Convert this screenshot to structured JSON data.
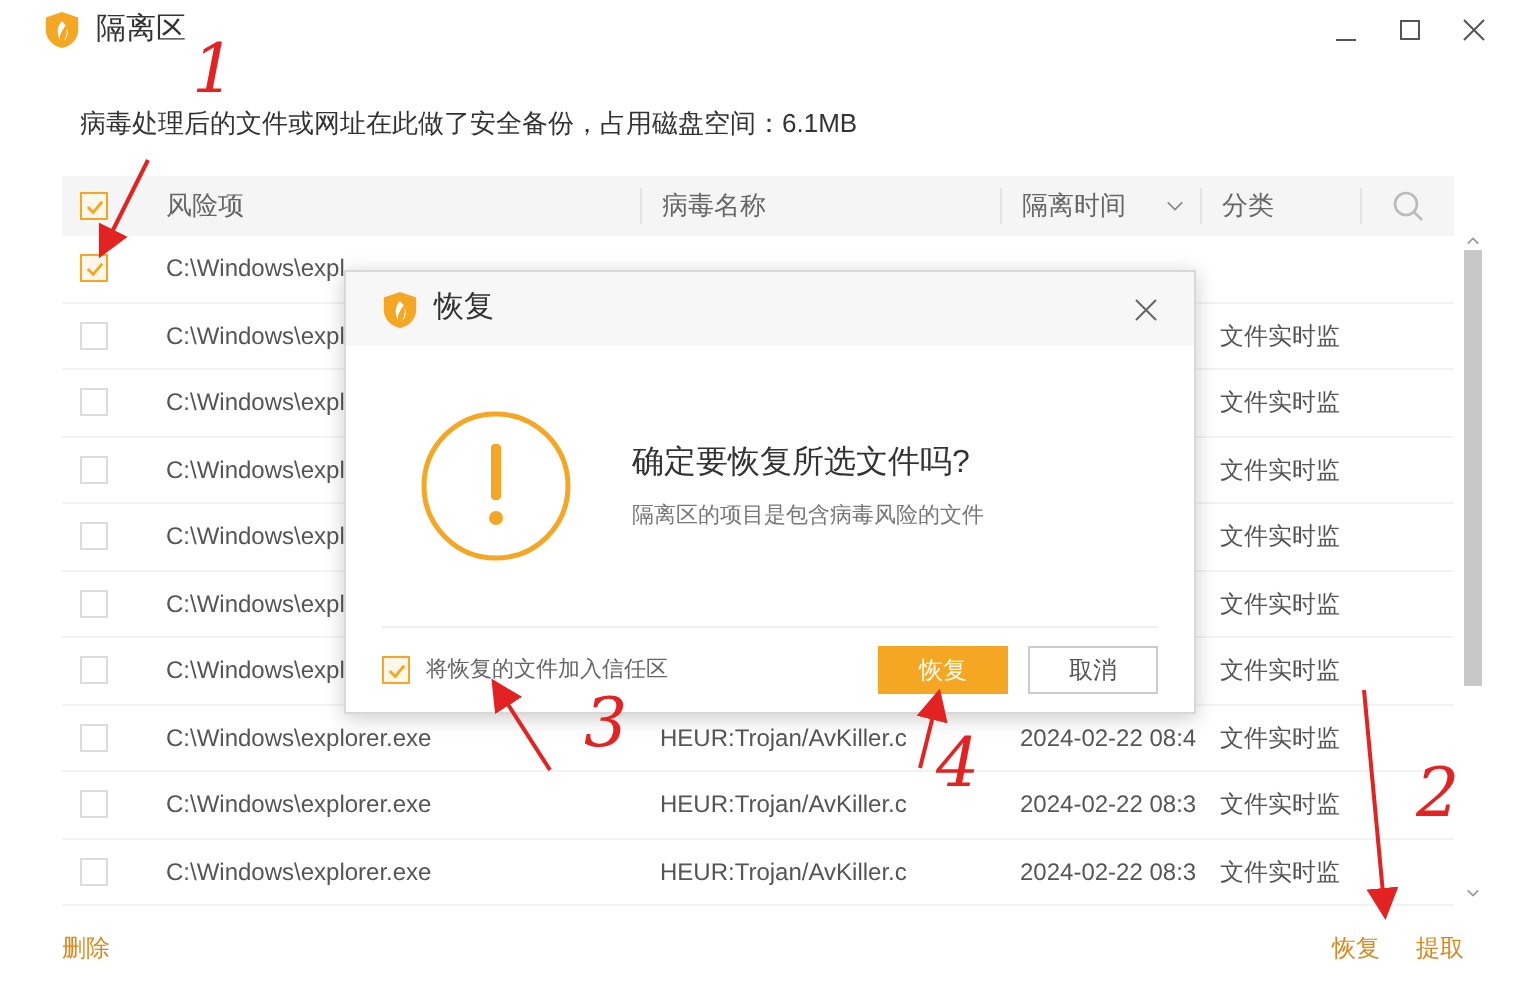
{
  "window": {
    "title": "隔离区"
  },
  "notice": "病毒处理后的文件或网址在此做了安全备份，占用磁盘空间：6.1MB",
  "table": {
    "select_all": {
      "checked": true
    },
    "columns": [
      {
        "label": "风险项"
      },
      {
        "label": "病毒名称"
      },
      {
        "label": "隔离时间",
        "sortable": true
      },
      {
        "label": "分类"
      }
    ],
    "rows": [
      {
        "checked": true,
        "risk_item": "C:\\Windows\\expl"
      },
      {
        "checked": false,
        "risk_item": "C:\\Windows\\expl",
        "category": "文件实时监"
      },
      {
        "checked": false,
        "risk_item": "C:\\Windows\\expl",
        "category": "文件实时监"
      },
      {
        "checked": false,
        "risk_item": "C:\\Windows\\expl",
        "category": "文件实时监"
      },
      {
        "checked": false,
        "risk_item": "C:\\Windows\\expl",
        "category": "文件实时监"
      },
      {
        "checked": false,
        "risk_item": "C:\\Windows\\expl",
        "category": "文件实时监"
      },
      {
        "checked": false,
        "risk_item": "C:\\Windows\\expl",
        "category": "文件实时监"
      },
      {
        "checked": false,
        "risk_item": "C:\\Windows\\explorer.exe",
        "virus_name": "HEUR:Trojan/AvKiller.c",
        "time": "2024-02-22 08:4",
        "category": "文件实时监"
      },
      {
        "checked": false,
        "risk_item": "C:\\Windows\\explorer.exe",
        "virus_name": "HEUR:Trojan/AvKiller.c",
        "time": "2024-02-22 08:3",
        "category": "文件实时监"
      },
      {
        "checked": false,
        "risk_item": "C:\\Windows\\explorer.exe",
        "virus_name": "HEUR:Trojan/AvKiller.c",
        "time": "2024-02-22 08:3",
        "category": "文件实时监"
      }
    ]
  },
  "footer": {
    "delete": "删除",
    "restore": "恢复",
    "extract": "提取"
  },
  "dialog": {
    "title": "恢复",
    "heading": "确定要恢复所选文件吗?",
    "message": "隔离区的项目是包含病毒风险的文件",
    "trust": {
      "label": "将恢复的文件加入信任区",
      "checked": true
    },
    "buttons": [
      {
        "label": "恢复",
        "kind": "primary"
      },
      {
        "label": "取消",
        "kind": "secondary"
      }
    ]
  },
  "annotations": [
    {
      "label": "1"
    },
    {
      "label": "2"
    },
    {
      "label": "3"
    },
    {
      "label": "4"
    }
  ]
}
